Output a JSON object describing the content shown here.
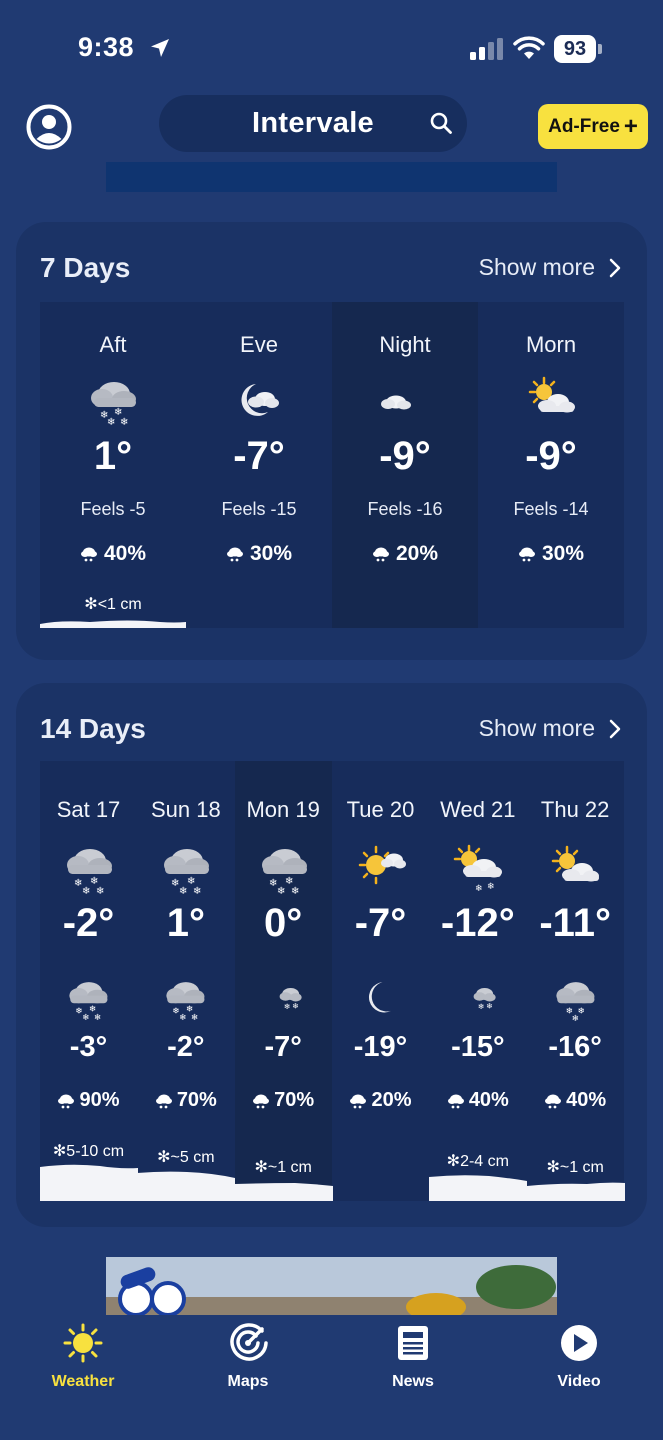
{
  "status_bar": {
    "time": "9:38",
    "battery": "93"
  },
  "header": {
    "location": "Intervale",
    "ad_free_label": "Ad-Free"
  },
  "seven_days": {
    "title": "7 Days",
    "show_more": "Show more",
    "periods": [
      {
        "label": "Aft",
        "icon": "snow-cloud-icon",
        "temp": "1°",
        "feels": "Feels -5",
        "precip": "40%",
        "snow": "<1 cm"
      },
      {
        "label": "Eve",
        "icon": "partly-cloudy-night-icon",
        "temp": "-7°",
        "feels": "Feels -15",
        "precip": "30%",
        "snow": ""
      },
      {
        "label": "Night",
        "icon": "partly-cloudy-night-icon",
        "temp": "-9°",
        "feels": "Feels -16",
        "precip": "20%",
        "snow": ""
      },
      {
        "label": "Morn",
        "icon": "partly-sunny-icon",
        "temp": "-9°",
        "feels": "Feels -14",
        "precip": "30%",
        "snow": ""
      }
    ]
  },
  "fourteen_days": {
    "title": "14 Days",
    "show_more": "Show more",
    "days": [
      {
        "day": "Sat 17",
        "day_icon": "snow-cloud-icon",
        "high": "-2°",
        "night_icon": "snow-cloud-icon",
        "low": "-3°",
        "precip": "90%",
        "snow": "5-10 cm"
      },
      {
        "day": "Sun 18",
        "day_icon": "snow-cloud-icon",
        "high": "1°",
        "night_icon": "snow-cloud-icon",
        "low": "-2°",
        "precip": "70%",
        "snow": "~5 cm"
      },
      {
        "day": "Mon 19",
        "day_icon": "snow-cloud-icon",
        "high": "0°",
        "night_icon": "moon-snow-icon",
        "low": "-7°",
        "precip": "70%",
        "snow": "~1 cm"
      },
      {
        "day": "Tue 20",
        "day_icon": "sunny-cloud-icon",
        "high": "-7°",
        "night_icon": "moon-icon",
        "low": "-19°",
        "precip": "20%",
        "snow": ""
      },
      {
        "day": "Wed 21",
        "day_icon": "sun-snow-cloud-icon",
        "high": "-12°",
        "night_icon": "moon-snow-icon",
        "low": "-15°",
        "precip": "40%",
        "snow": "2-4 cm"
      },
      {
        "day": "Thu 22",
        "day_icon": "partly-sunny-icon",
        "high": "-11°",
        "night_icon": "snow-cloud-icon",
        "low": "-16°",
        "precip": "40%",
        "snow": "~1 cm"
      }
    ]
  },
  "nav": {
    "weather": "Weather",
    "maps": "Maps",
    "news": "News",
    "video": "Video"
  },
  "colors": {
    "background": "#203a72",
    "card": "#1b3366",
    "accent_yellow": "#f8e13f"
  }
}
